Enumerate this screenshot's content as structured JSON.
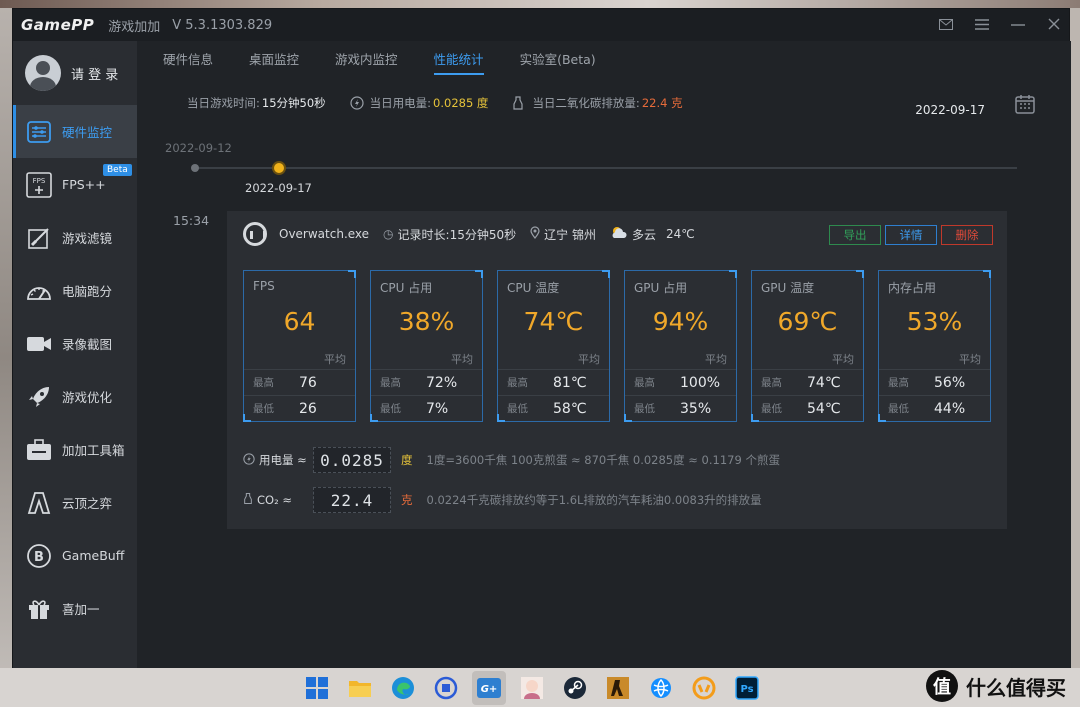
{
  "app": {
    "logo": "GamePP",
    "name": "游戏加加",
    "version": "V 5.3.1303.829"
  },
  "sidebar": {
    "user_label": "请 登 录",
    "items": [
      {
        "label": "硬件监控",
        "icon": "hardware-monitor-icon"
      },
      {
        "label": "FPS++",
        "icon": "fps-icon",
        "badge": "Beta"
      },
      {
        "label": "游戏滤镜",
        "icon": "filter-icon"
      },
      {
        "label": "电脑跑分",
        "icon": "benchmark-icon"
      },
      {
        "label": "录像截图",
        "icon": "video-icon"
      },
      {
        "label": "游戏优化",
        "icon": "rocket-icon"
      },
      {
        "label": "加加工具箱",
        "icon": "toolbox-icon"
      },
      {
        "label": "云顶之弈",
        "icon": "tft-icon"
      },
      {
        "label": "GameBuff",
        "icon": "gamebuff-icon"
      },
      {
        "label": "喜加一",
        "icon": "gift-icon"
      }
    ]
  },
  "tabs": [
    "硬件信息",
    "桌面监控",
    "游戏内监控",
    "性能统计",
    "实验室(Beta)"
  ],
  "stats": {
    "play_time_label": "当日游戏时间:",
    "play_time": "15分钟50秒",
    "power_label": "当日用电量:",
    "power": "0.0285 度",
    "co2_label": "当日二氧化碳排放量:",
    "co2": "22.4 克",
    "date": "2022-09-17"
  },
  "timeline": {
    "start_date": "2022-09-12",
    "selected_date": "2022-09-17"
  },
  "session": {
    "time": "15:34",
    "game": "Overwatch.exe",
    "duration": "记录时长:15分钟50秒",
    "location": "辽宁 锦州",
    "weather": "多云",
    "temp": "24℃",
    "btn_export": "导出",
    "btn_detail": "详情",
    "btn_delete": "删除",
    "avg_label": "平均",
    "max_label": "最高",
    "min_label": "最低",
    "metrics": [
      {
        "title": "FPS",
        "value": "64",
        "max": "76",
        "min": "26"
      },
      {
        "title": "CPU 占用",
        "value": "38%",
        "max": "72%",
        "min": "7%"
      },
      {
        "title": "CPU 温度",
        "value": "74℃",
        "max": "81℃",
        "min": "58℃"
      },
      {
        "title": "GPU 占用",
        "value": "94%",
        "max": "100%",
        "min": "35%"
      },
      {
        "title": "GPU 温度",
        "value": "69℃",
        "max": "74℃",
        "min": "54℃"
      },
      {
        "title": "内存占用",
        "value": "53%",
        "max": "56%",
        "min": "44%"
      }
    ],
    "energy": {
      "label": "用电量 ≈",
      "value": "0.0285",
      "unit": "度",
      "desc": "1度=3600千焦     100克煎蛋 ≈ 870千焦     0.0285度 ≈ 0.1179 个煎蛋"
    },
    "co2": {
      "label": "CO₂ ≈",
      "value": "22.4",
      "unit": "克",
      "desc": "0.0224千克碳排放约等于1.6L排放的汽车耗油0.0083升的排放量"
    }
  },
  "watermark": {
    "badge": "值",
    "text": "什么值得买"
  },
  "colors": {
    "accent": "#3d9cf0",
    "metric_value": "#f0a82a",
    "power": "#e6c33a",
    "co2": "#e66b3a"
  }
}
